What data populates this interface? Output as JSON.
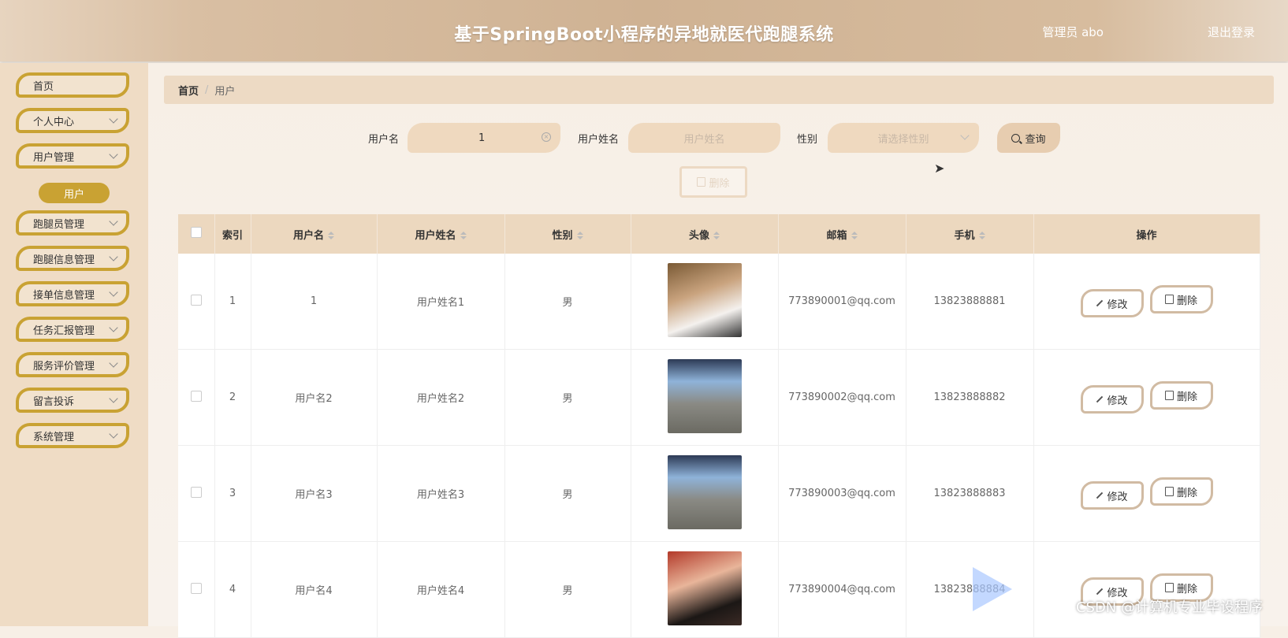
{
  "header": {
    "title": "基于SpringBoot小程序的异地就医代跑腿系统",
    "admin": "管理员 abo",
    "logout": "退出登录"
  },
  "sidebar": {
    "items": [
      {
        "label": "首页"
      },
      {
        "label": "个人中心"
      },
      {
        "label": "用户管理"
      },
      {
        "label": "跑腿员管理"
      },
      {
        "label": "跑腿信息管理"
      },
      {
        "label": "接单信息管理"
      },
      {
        "label": "任务汇报管理"
      },
      {
        "label": "服务评价管理"
      },
      {
        "label": "留言投诉"
      },
      {
        "label": "系统管理"
      }
    ],
    "sub_active": "用户"
  },
  "breadcrumb": {
    "home": "首页",
    "sep": "/",
    "current": "用户"
  },
  "search": {
    "username_label": "用户名",
    "username_value": "1",
    "name_label": "用户姓名",
    "name_placeholder": "用户姓名",
    "gender_label": "性别",
    "gender_placeholder": "请选择性别",
    "query_label": "查询",
    "delete_label": "删除"
  },
  "table": {
    "headers": [
      "索引",
      "用户名",
      "用户姓名",
      "性别",
      "头像",
      "邮箱",
      "手机",
      "操作"
    ],
    "rows": [
      {
        "index": "1",
        "username": "1",
        "name": "用户姓名1",
        "gender": "男",
        "email": "773890001@qq.com",
        "phone": "13823888881",
        "edit": "修改",
        "delete": "删除",
        "avatar_color": "#6f5a3a"
      },
      {
        "index": "2",
        "username": "用户名2",
        "name": "用户姓名2",
        "gender": "男",
        "email": "773890002@qq.com",
        "phone": "13823888882",
        "edit": "修改",
        "delete": "删除",
        "avatar_color": "#8a8d90"
      },
      {
        "index": "3",
        "username": "用户名3",
        "name": "用户姓名3",
        "gender": "男",
        "email": "773890003@qq.com",
        "phone": "13823888883",
        "edit": "修改",
        "delete": "删除",
        "avatar_color": "#8a8d90"
      },
      {
        "index": "4",
        "username": "用户名4",
        "name": "用户姓名4",
        "gender": "男",
        "email": "773890004@qq.com",
        "phone": "13823888884",
        "edit": "修改",
        "delete": "删除",
        "avatar_color": "#7a4030"
      }
    ]
  },
  "watermark": "CSDN @计算机专业毕设程序",
  "colors": {
    "accent": "#c9a233",
    "header_bg": "#d9bfa3",
    "table_header": "#ecd8bf"
  }
}
